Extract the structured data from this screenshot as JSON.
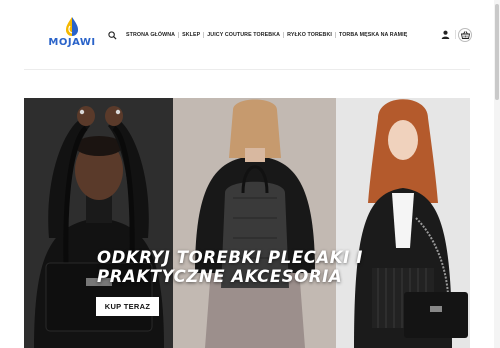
{
  "header": {
    "logo_text": "MOJAWI",
    "nav": [
      {
        "label": "STRONA GŁÓWNA"
      },
      {
        "label": "SKLEP"
      },
      {
        "label": "JUICY COUTURE TOREBKA"
      },
      {
        "label": "RYŁKO TOREBKI"
      },
      {
        "label": "TORBA MĘSKA NA RAMIĘ"
      }
    ],
    "icons": [
      "search-icon",
      "user-icon",
      "shopping-basket-icon"
    ]
  },
  "hero": {
    "title_line1": "ODKRYJ TOREBKI PLECAKI I",
    "title_line2": "PRAKTYCZNE AKCESORIA",
    "cta_label": "KUP TERAZ"
  },
  "colors": {
    "brand_blue": "#2a63c9",
    "brand_yellow": "#f5b800",
    "text_dark": "#222222",
    "cta_bg": "#ffffff"
  }
}
